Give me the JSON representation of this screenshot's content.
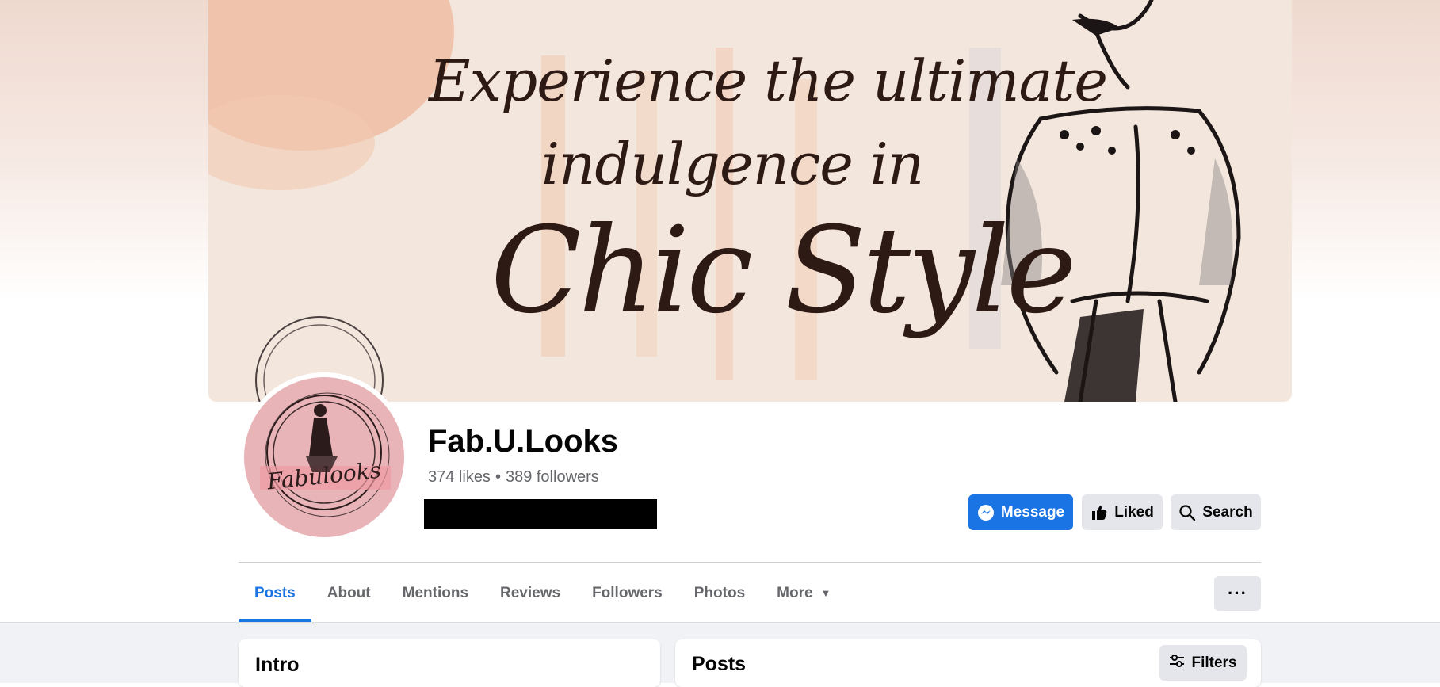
{
  "cover": {
    "lines": [
      "Experience the ultimate",
      "indulgence in",
      "Chic Style"
    ]
  },
  "avatar": {
    "logo_text": "Fabulooks"
  },
  "profile": {
    "name": "Fab.U.Looks",
    "likes": "374 likes",
    "followers": "389 followers",
    "separator": "•"
  },
  "actions": {
    "message_label": "Message",
    "liked_label": "Liked",
    "search_label": "Search"
  },
  "tabs": [
    {
      "label": "Posts",
      "active": true
    },
    {
      "label": "About"
    },
    {
      "label": "Mentions"
    },
    {
      "label": "Reviews"
    },
    {
      "label": "Followers"
    },
    {
      "label": "Photos"
    },
    {
      "label": "More"
    }
  ],
  "more_options_label": "···",
  "intro": {
    "title": "Intro"
  },
  "posts": {
    "title": "Posts",
    "filters_label": "Filters"
  },
  "colors": {
    "accent": "#1b74e4",
    "button_gray": "#e4e6eb",
    "secondary_text": "#65676b"
  }
}
